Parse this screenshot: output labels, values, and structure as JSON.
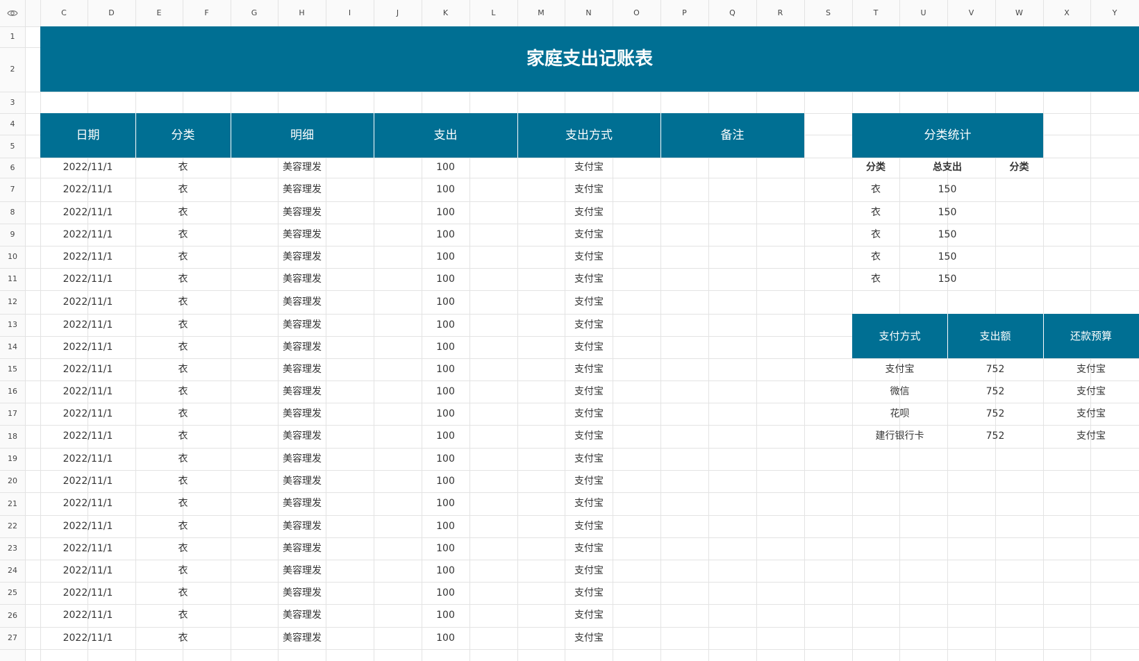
{
  "columns": [
    "C",
    "D",
    "E",
    "F",
    "G",
    "H",
    "I",
    "J",
    "K",
    "L",
    "M",
    "N",
    "O",
    "P",
    "Q",
    "R",
    "S",
    "T",
    "U",
    "V",
    "W",
    "X",
    "Y"
  ],
  "rows": [
    "1",
    "2",
    "3",
    "4",
    "5",
    "6",
    "7",
    "8",
    "9",
    "10",
    "11",
    "12",
    "13",
    "14",
    "15",
    "16",
    "17",
    "18",
    "19",
    "20",
    "21",
    "22",
    "23",
    "24",
    "25",
    "26",
    "27"
  ],
  "title": "家庭支出记账表",
  "main_table": {
    "headers": [
      "日期",
      "分类",
      "明细",
      "支出",
      "支出方式",
      "备注"
    ],
    "rows": [
      [
        "2022/11/1",
        "衣",
        "美容理发",
        "100",
        "支付宝",
        ""
      ],
      [
        "2022/11/1",
        "衣",
        "美容理发",
        "100",
        "支付宝",
        ""
      ],
      [
        "2022/11/1",
        "衣",
        "美容理发",
        "100",
        "支付宝",
        ""
      ],
      [
        "2022/11/1",
        "衣",
        "美容理发",
        "100",
        "支付宝",
        ""
      ],
      [
        "2022/11/1",
        "衣",
        "美容理发",
        "100",
        "支付宝",
        ""
      ],
      [
        "2022/11/1",
        "衣",
        "美容理发",
        "100",
        "支付宝",
        ""
      ],
      [
        "2022/11/1",
        "衣",
        "美容理发",
        "100",
        "支付宝",
        ""
      ],
      [
        "2022/11/1",
        "衣",
        "美容理发",
        "100",
        "支付宝",
        ""
      ],
      [
        "2022/11/1",
        "衣",
        "美容理发",
        "100",
        "支付宝",
        ""
      ],
      [
        "2022/11/1",
        "衣",
        "美容理发",
        "100",
        "支付宝",
        ""
      ],
      [
        "2022/11/1",
        "衣",
        "美容理发",
        "100",
        "支付宝",
        ""
      ],
      [
        "2022/11/1",
        "衣",
        "美容理发",
        "100",
        "支付宝",
        ""
      ],
      [
        "2022/11/1",
        "衣",
        "美容理发",
        "100",
        "支付宝",
        ""
      ],
      [
        "2022/11/1",
        "衣",
        "美容理发",
        "100",
        "支付宝",
        ""
      ],
      [
        "2022/11/1",
        "衣",
        "美容理发",
        "100",
        "支付宝",
        ""
      ],
      [
        "2022/11/1",
        "衣",
        "美容理发",
        "100",
        "支付宝",
        ""
      ],
      [
        "2022/11/1",
        "衣",
        "美容理发",
        "100",
        "支付宝",
        ""
      ],
      [
        "2022/11/1",
        "衣",
        "美容理发",
        "100",
        "支付宝",
        ""
      ],
      [
        "2022/11/1",
        "衣",
        "美容理发",
        "100",
        "支付宝",
        ""
      ],
      [
        "2022/11/1",
        "衣",
        "美容理发",
        "100",
        "支付宝",
        ""
      ],
      [
        "2022/11/1",
        "衣",
        "美容理发",
        "100",
        "支付宝",
        ""
      ],
      [
        "2022/11/1",
        "衣",
        "美容理发",
        "100",
        "支付宝",
        ""
      ]
    ]
  },
  "category_stats": {
    "title": "分类统计",
    "headers": [
      "分类",
      "总支出",
      "分类"
    ],
    "rows": [
      [
        "衣",
        "150",
        ""
      ],
      [
        "衣",
        "150",
        ""
      ],
      [
        "衣",
        "150",
        ""
      ],
      [
        "衣",
        "150",
        ""
      ],
      [
        "衣",
        "150",
        ""
      ]
    ]
  },
  "payment_table": {
    "headers": [
      "支付方式",
      "支出额",
      "还款预算"
    ],
    "rows": [
      [
        "支付宝",
        "752",
        "支付宝"
      ],
      [
        "微信",
        "752",
        "支付宝"
      ],
      [
        "花呗",
        "752",
        "支付宝"
      ],
      [
        "建行银行卡",
        "752",
        "支付宝"
      ]
    ]
  },
  "colors": {
    "accent": "#006f93",
    "grid": "#e3e3e3",
    "header_bg": "#fafafa"
  }
}
